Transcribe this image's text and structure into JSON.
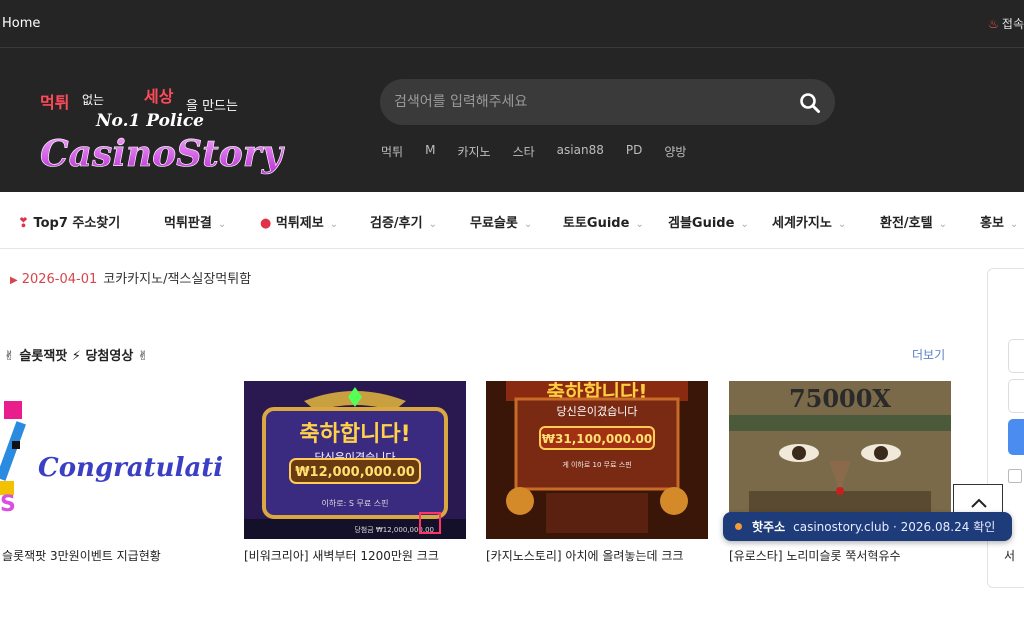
{
  "topbar": {
    "home_label": "Home",
    "connect_label": "접속"
  },
  "header": {
    "logo": {
      "line1_a": "먹튀",
      "line1_b": "없는",
      "line1_c": "세상",
      "line1_d": "을 만드는",
      "line2": "No.1 Police",
      "brand": "CasinoStory"
    },
    "search": {
      "placeholder": "검색어를 입력해주세요"
    },
    "keywords": [
      "먹튀",
      "M",
      "카지노",
      "스타",
      "asian88",
      "PD",
      "양방"
    ]
  },
  "nav": {
    "items": [
      {
        "label": "Top7 주소찾기",
        "icon": "heart-icon",
        "caret": false
      },
      {
        "label": "먹튀판결",
        "caret": true
      },
      {
        "label": "먹튀제보",
        "icon": "siren-icon",
        "caret": true
      },
      {
        "label": "검증/후기",
        "caret": true
      },
      {
        "label": "무료슬롯",
        "caret": true
      },
      {
        "label": "토토Guide",
        "caret": true
      },
      {
        "label": "겜블Guide",
        "caret": true
      },
      {
        "label": "세계카지노",
        "caret": true
      },
      {
        "label": "환전/호텔",
        "caret": true
      },
      {
        "label": "홍보",
        "caret": true
      }
    ]
  },
  "ticker": {
    "date": "2026-04-01",
    "text": "코카카지노/잭스실장먹튀함"
  },
  "section": {
    "title": "✌ 슬롯잭팟 ⚡ 당첨영상 ✌",
    "more_label": "더보기",
    "cards": [
      {
        "caption": "슬롯잭팟 3만원이벤트 지급현황",
        "image_text": "Congratulati"
      },
      {
        "caption": "[비워크리아] 새벽부터 1200만원 크크",
        "image_title": "축하합니다!",
        "image_sub": "당신은이겼습니다",
        "image_amount": "₩12,000,000.00",
        "image_spin": "이하로: S 무료 스핀",
        "image_win": "당첨금 ₩12,000,000.00"
      },
      {
        "caption": "[카지노스토리] 아치에 올려놓는데 크크",
        "image_title": "축하합니다!",
        "image_sub": "당신은이겼습니다",
        "image_amount": "₩31,100,000.00",
        "image_spin": "게 이하로 10 무료 스핀"
      },
      {
        "caption": "[유로스타] 노리미슬롯 쭉서혁유수",
        "image_title": "75000X"
      }
    ]
  },
  "notice": {
    "label": "핫주소",
    "text": "casinostory.club · 2026.08.24 확인"
  },
  "side_caption": "서",
  "colors": {
    "header_bg": "#252525",
    "accent_red": "#d6454b",
    "notice_bg": "#1f3c7a",
    "link_blue": "#5a7fc9"
  }
}
